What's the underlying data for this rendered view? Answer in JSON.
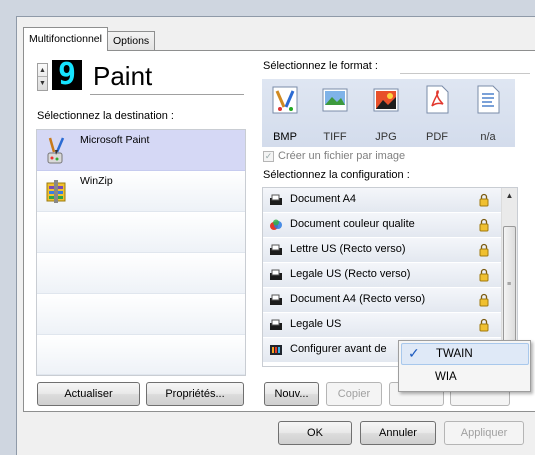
{
  "tabs": [
    {
      "label": "Multifonctionnel",
      "active": true
    },
    {
      "label": "Options",
      "active": false
    }
  ],
  "device": {
    "lcd_digit": "9",
    "name": "Paint"
  },
  "destination": {
    "label": "Sélectionnez la destination :",
    "items": [
      {
        "label": "Microsoft Paint",
        "icon": "paint-icon",
        "selected": true
      },
      {
        "label": "WinZip",
        "icon": "winzip-icon",
        "selected": false
      }
    ],
    "refresh_button": "Actualiser",
    "properties_button": "Propriétés..."
  },
  "format": {
    "label": "Sélectionnez le format :",
    "items": [
      {
        "label": "BMP",
        "icon": "bmp-icon",
        "selected": true
      },
      {
        "label": "TIFF",
        "icon": "tiff-icon",
        "selected": false
      },
      {
        "label": "JPG",
        "icon": "jpg-icon",
        "selected": false
      },
      {
        "label": "PDF",
        "icon": "pdf-icon",
        "selected": false
      },
      {
        "label": "n/a",
        "icon": "text-doc-icon",
        "selected": false
      }
    ],
    "one_file_per_image": {
      "label": "Créer un fichier par image",
      "checked": true,
      "enabled": false
    }
  },
  "configuration": {
    "label": "Sélectionnez la configuration :",
    "items": [
      {
        "label": "Document A4",
        "icon": "scanner-icon",
        "locked": true
      },
      {
        "label": "Document couleur qualite",
        "icon": "color-scan-icon",
        "locked": true
      },
      {
        "label": "Lettre US (Recto verso)",
        "icon": "scanner-icon",
        "locked": true
      },
      {
        "label": "Legale US (Recto verso)",
        "icon": "scanner-icon",
        "locked": true
      },
      {
        "label": "Document A4 (Recto verso)",
        "icon": "scanner-icon",
        "locked": true
      },
      {
        "label": "Legale US",
        "icon": "scanner-icon",
        "locked": true
      },
      {
        "label": "Configurer avant de",
        "icon": "configure-icon",
        "locked": false
      }
    ],
    "new_button": "Nouv...",
    "copy_button": "Copier"
  },
  "popup_menu": {
    "items": [
      {
        "label": "TWAIN",
        "checked": true
      },
      {
        "label": "WIA",
        "checked": false
      }
    ]
  },
  "footer": {
    "ok": "OK",
    "cancel": "Annuler",
    "apply": "Appliquer"
  },
  "colors": {
    "lcd_digit": "#16e4ff",
    "selection": "#d5d8f5",
    "format_bar": "#d8e0ee"
  }
}
